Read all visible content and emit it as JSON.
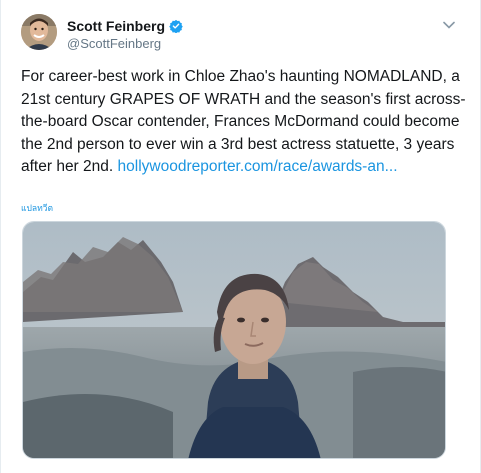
{
  "tweet": {
    "author": {
      "display_name": "Scott Feinberg",
      "handle": "@ScottFeinberg",
      "verified": true
    },
    "text": "For career-best work in Chloe Zhao's haunting NOMADLAND, a 21st century GRAPES OF WRATH and the season's first across-the-board Oscar contender, Frances McDormand could become the 2nd person to ever win a 3rd best actress statuette, 3 years after her 2nd. ",
    "link_text": "hollywoodreporter.com/race/awards-an...",
    "translate_label": "แปลทวีต",
    "more_icon": "chevron-down-icon"
  },
  "colors": {
    "link": "#1b95e0",
    "verified": "#1da1f2",
    "secondary_text": "#657786"
  }
}
